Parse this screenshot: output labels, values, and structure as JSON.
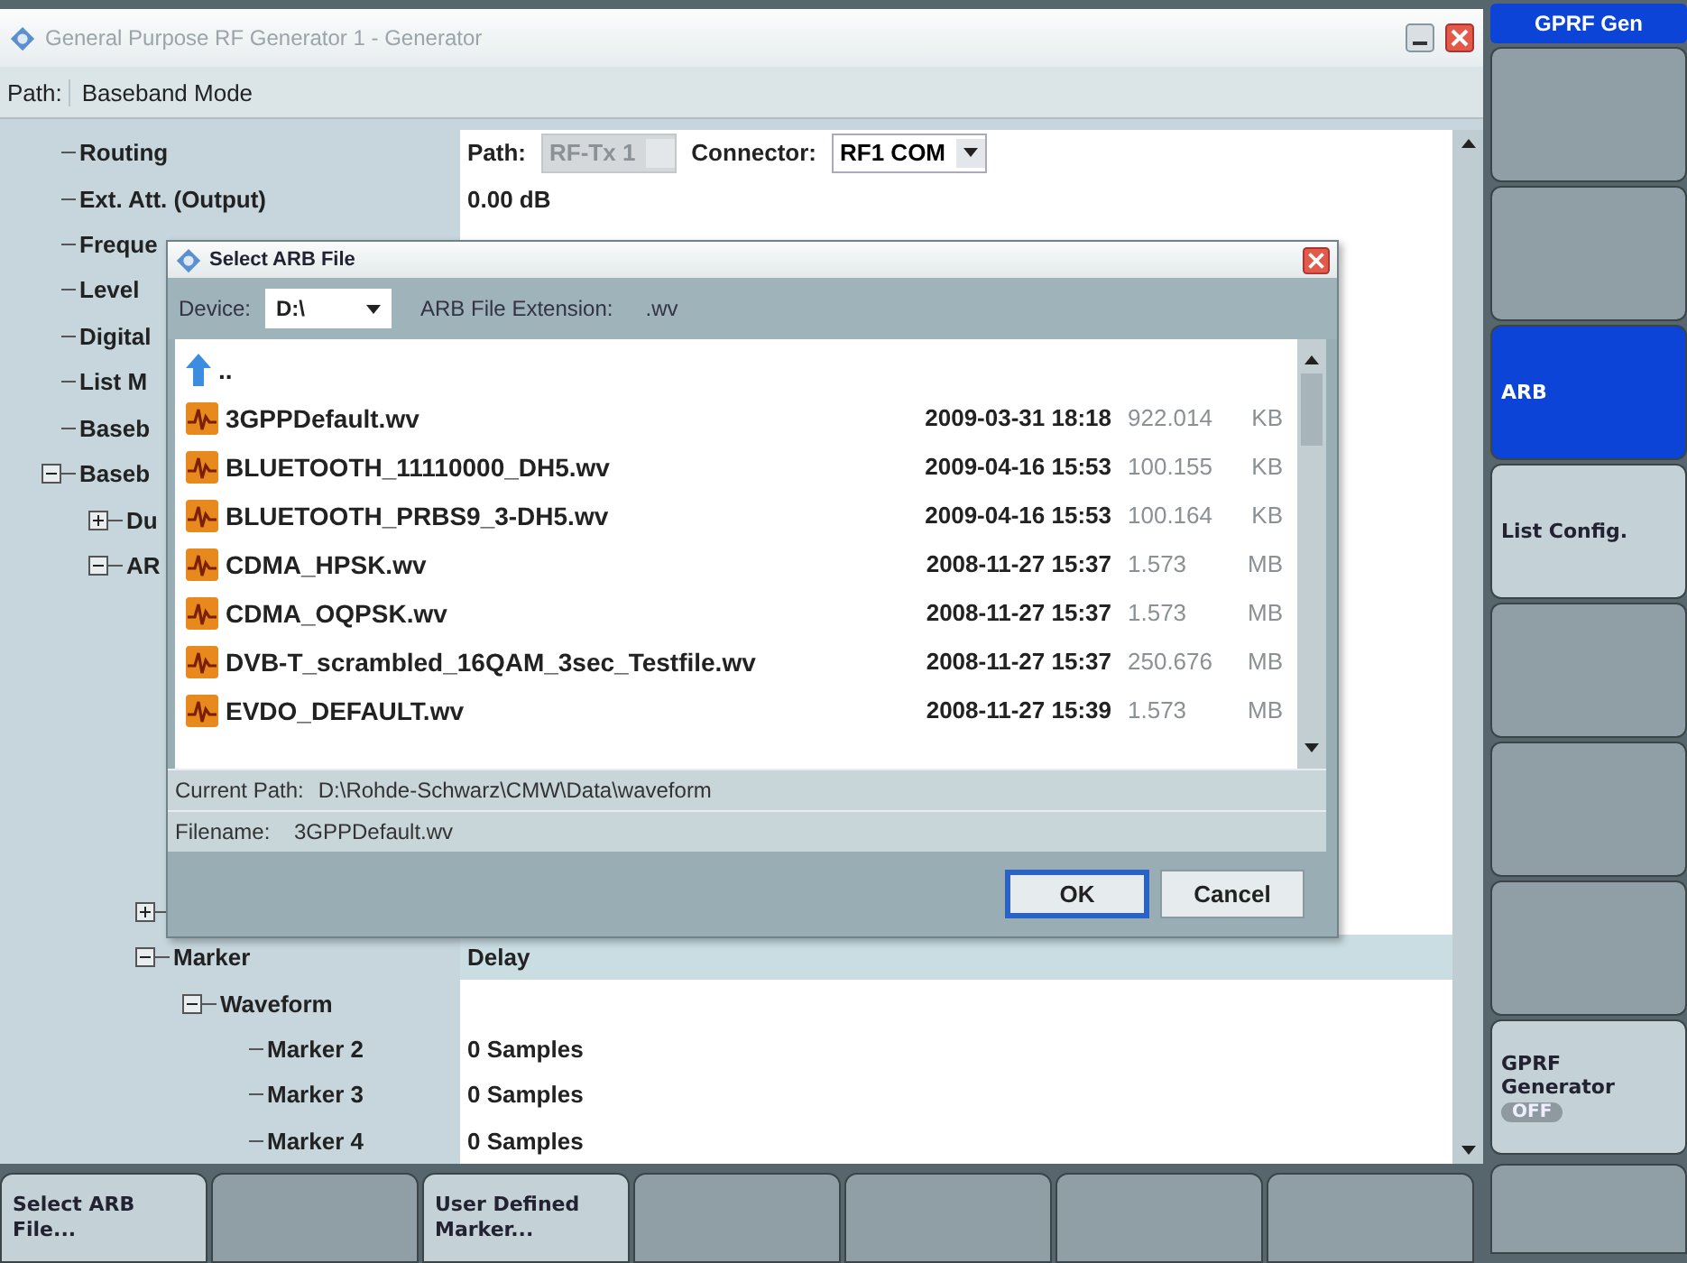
{
  "window": {
    "title": "General Purpose RF Generator 1 - Generator"
  },
  "path_bar": {
    "label": "Path:",
    "value": "Baseband Mode"
  },
  "tree": [
    {
      "label": "Routing",
      "value": {
        "kind": "routing",
        "path_label": "Path:",
        "path_value": "RF-Tx 1",
        "path_disabled": true,
        "connector_label": "Connector:",
        "connector_value": "RF1 COM"
      }
    },
    {
      "label": "Ext. Att. (Output)",
      "value": {
        "kind": "text",
        "text": "0.00 dB"
      }
    },
    {
      "label": "Freque"
    },
    {
      "label": "Level"
    },
    {
      "label": "Digital"
    },
    {
      "label": "List M"
    },
    {
      "label": "Baseb"
    },
    {
      "label": "Baseb",
      "expanded": true,
      "children": [
        {
          "label": "Du",
          "expanded": false
        },
        {
          "label": "AR",
          "expanded": true,
          "children": [
            {
              "expanded": false
            },
            {
              "label": "Marker",
              "expanded": true,
              "value": {
                "kind": "header",
                "text": "Delay"
              },
              "children": [
                {
                  "label": "Waveform",
                  "expanded": true,
                  "children": [
                    {
                      "label": "Marker 2",
                      "value": {
                        "kind": "text",
                        "text": "0 Samples"
                      }
                    },
                    {
                      "label": "Marker 3",
                      "value": {
                        "kind": "text",
                        "text": "0 Samples"
                      }
                    },
                    {
                      "label": "Marker 4",
                      "value": {
                        "kind": "text",
                        "text": "0 Samples"
                      }
                    }
                  ]
                }
              ]
            }
          ]
        }
      ]
    }
  ],
  "dialog": {
    "title": "Select ARB File",
    "device_label": "Device:",
    "device_value": "D:\\",
    "extension_label": "ARB File Extension:",
    "extension_value": ".wv",
    "parent_entry": "..",
    "files": [
      {
        "name": "3GPPDefault.wv",
        "date": "2009-03-31 18:18",
        "size": "922.014",
        "unit": "KB"
      },
      {
        "name": "BLUETOOTH_11110000_DH5.wv",
        "date": "2009-04-16 15:53",
        "size": "100.155",
        "unit": "KB"
      },
      {
        "name": "BLUETOOTH_PRBS9_3-DH5.wv",
        "date": "2009-04-16 15:53",
        "size": "100.164",
        "unit": "KB"
      },
      {
        "name": "CDMA_HPSK.wv",
        "date": "2008-11-27 15:37",
        "size": "1.573",
        "unit": "MB"
      },
      {
        "name": "CDMA_OQPSK.wv",
        "date": "2008-11-27 15:37",
        "size": "1.573",
        "unit": "MB"
      },
      {
        "name": "DVB-T_scrambled_16QAM_3sec_Testfile.wv",
        "date": "2008-11-27 15:37",
        "size": "250.676",
        "unit": "MB"
      },
      {
        "name": "EVDO_DEFAULT.wv",
        "date": "2008-11-27 15:39",
        "size": "1.573",
        "unit": "MB"
      }
    ],
    "current_path_label": "Current Path:",
    "current_path": "D:\\Rohde-Schwarz\\CMW\\Data\\waveform",
    "filename_label": "Filename:",
    "filename": "3GPPDefault.wv",
    "buttons": [
      {
        "label": "OK",
        "focused": true
      },
      {
        "label": "Cancel",
        "focused": false
      }
    ]
  },
  "side_title": "GPRF Gen",
  "side_keys": [
    {
      "selected": false
    },
    {
      "selected": false
    },
    {
      "label": "ARB",
      "selected": true
    },
    {
      "label": "List Config.",
      "selected": false
    },
    {
      "selected": false
    },
    {
      "selected": false
    },
    {
      "selected": false
    },
    {
      "label": "GPRF Generator",
      "badge": "OFF",
      "selected": false
    }
  ],
  "bottom_keys": [
    {
      "kind": "labeled",
      "label": "Select ARB File..."
    },
    {
      "kind": "blank"
    },
    {
      "kind": "labeled",
      "label": "User Defined Marker..."
    },
    {
      "kind": "blank"
    },
    {
      "kind": "blank"
    },
    {
      "kind": "blank"
    },
    {
      "kind": "blank"
    },
    {
      "kind": "blank"
    }
  ]
}
